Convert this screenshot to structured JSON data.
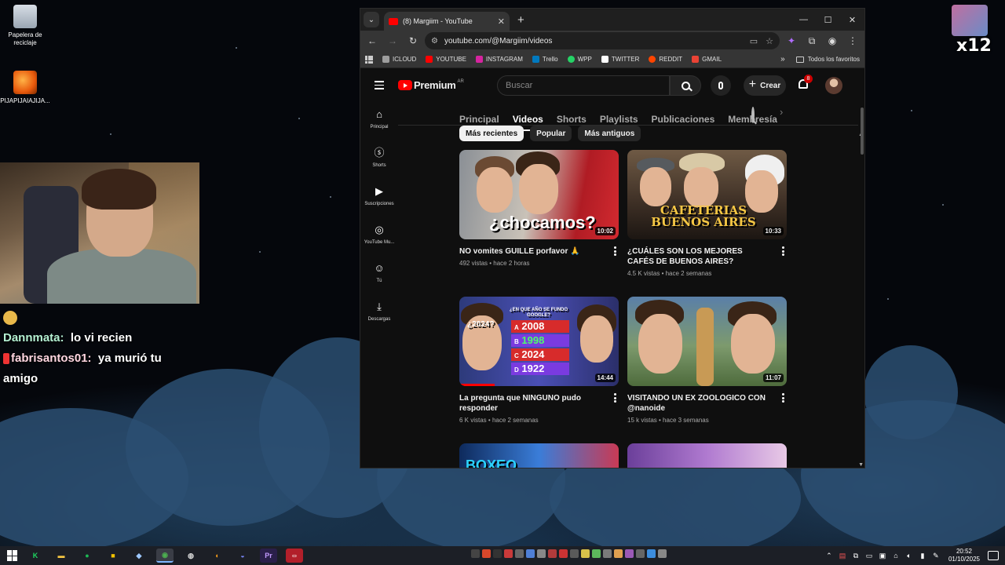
{
  "desktop": {
    "icons": [
      {
        "label": "Papelera de reciclaje"
      },
      {
        "label": "PIJAPIJAIAJIJA..."
      }
    ]
  },
  "overlay": {
    "text": "x12"
  },
  "chat": [
    {
      "user": "Dannmata:",
      "message": "lo vi recien"
    },
    {
      "user": "fabrisantos01:",
      "message": "ya murió tu amigo"
    }
  ],
  "browser": {
    "tab_title": "(8) Margiim - YouTube",
    "url": "youtube.com/@Margiim/videos",
    "bookmarks": [
      {
        "label": "ICLOUD",
        "color": "#9e9e9e"
      },
      {
        "label": "YOUTUBE",
        "color": "#ff0000"
      },
      {
        "label": "INSTAGRAM",
        "color": "#d6249f"
      },
      {
        "label": "Trello",
        "color": "#0079bf"
      },
      {
        "label": "WPP",
        "color": "#25d366"
      },
      {
        "label": "TWITTER",
        "color": "#ffffff"
      },
      {
        "label": "REDDIT",
        "color": "#ff4500"
      },
      {
        "label": "GMAIL",
        "color": "#ea4335"
      }
    ],
    "all_bookmarks": "Todos los favoritos"
  },
  "youtube": {
    "logo_text": "Premium",
    "country": "AR",
    "search_placeholder": "Buscar",
    "create_label": "Crear",
    "notification_count": "8",
    "guide": [
      {
        "label": "Principal",
        "icon": "home-icon"
      },
      {
        "label": "Shorts",
        "icon": "shorts-icon"
      },
      {
        "label": "Suscripciones",
        "icon": "subscriptions-icon"
      },
      {
        "label": "YouTube Mu...",
        "icon": "music-icon"
      },
      {
        "label": "Tú",
        "icon": "you-icon"
      },
      {
        "label": "Descargas",
        "icon": "download-icon"
      }
    ],
    "channel_tabs": [
      "Principal",
      "Videos",
      "Shorts",
      "Playlists",
      "Publicaciones",
      "Membresía"
    ],
    "active_tab": "Videos",
    "chips": [
      "Más recientes",
      "Popular",
      "Más antiguos"
    ],
    "selected_chip": "Más recientes",
    "videos": [
      {
        "title": "NO vomites GUILLE porfavor 🙏",
        "views": "492 vistas",
        "age": "hace 2 horas",
        "duration": "10:02",
        "thumb_text": "¿chocamos?",
        "progress": 0
      },
      {
        "title": "¿CUÁLES SON LOS MEJORES CAFÉS DE BUENOS AIRES?",
        "views": "4.5 K vistas",
        "age": "hace 2 semanas",
        "duration": "10:33",
        "thumb_text": "CAFETERIAS BUENOS AIRES",
        "progress": 0
      },
      {
        "title": "La pregunta que NINGUNO pudo responder",
        "views": "6 K vistas",
        "age": "hace 2 semanas",
        "duration": "14:44",
        "thumb_text": "¿EN QUE AÑO SE FUNDO GOOGLE?",
        "options": [
          "2008",
          "1998",
          "2024",
          "1922"
        ],
        "option_letters": [
          "A",
          "B",
          "C",
          "D"
        ],
        "thumb_year": "¿2024?",
        "progress": 0.22
      },
      {
        "title": "VISITANDO UN EX ZOOLOGICO CON @nanoide",
        "views": "15 k vistas",
        "age": "hace 3 semanas",
        "duration": "11:07",
        "progress": 0
      },
      {
        "thumb_text": "BOXEO"
      },
      {}
    ]
  },
  "taskbar": {
    "time": "20:52",
    "date": "01/10/2025"
  }
}
